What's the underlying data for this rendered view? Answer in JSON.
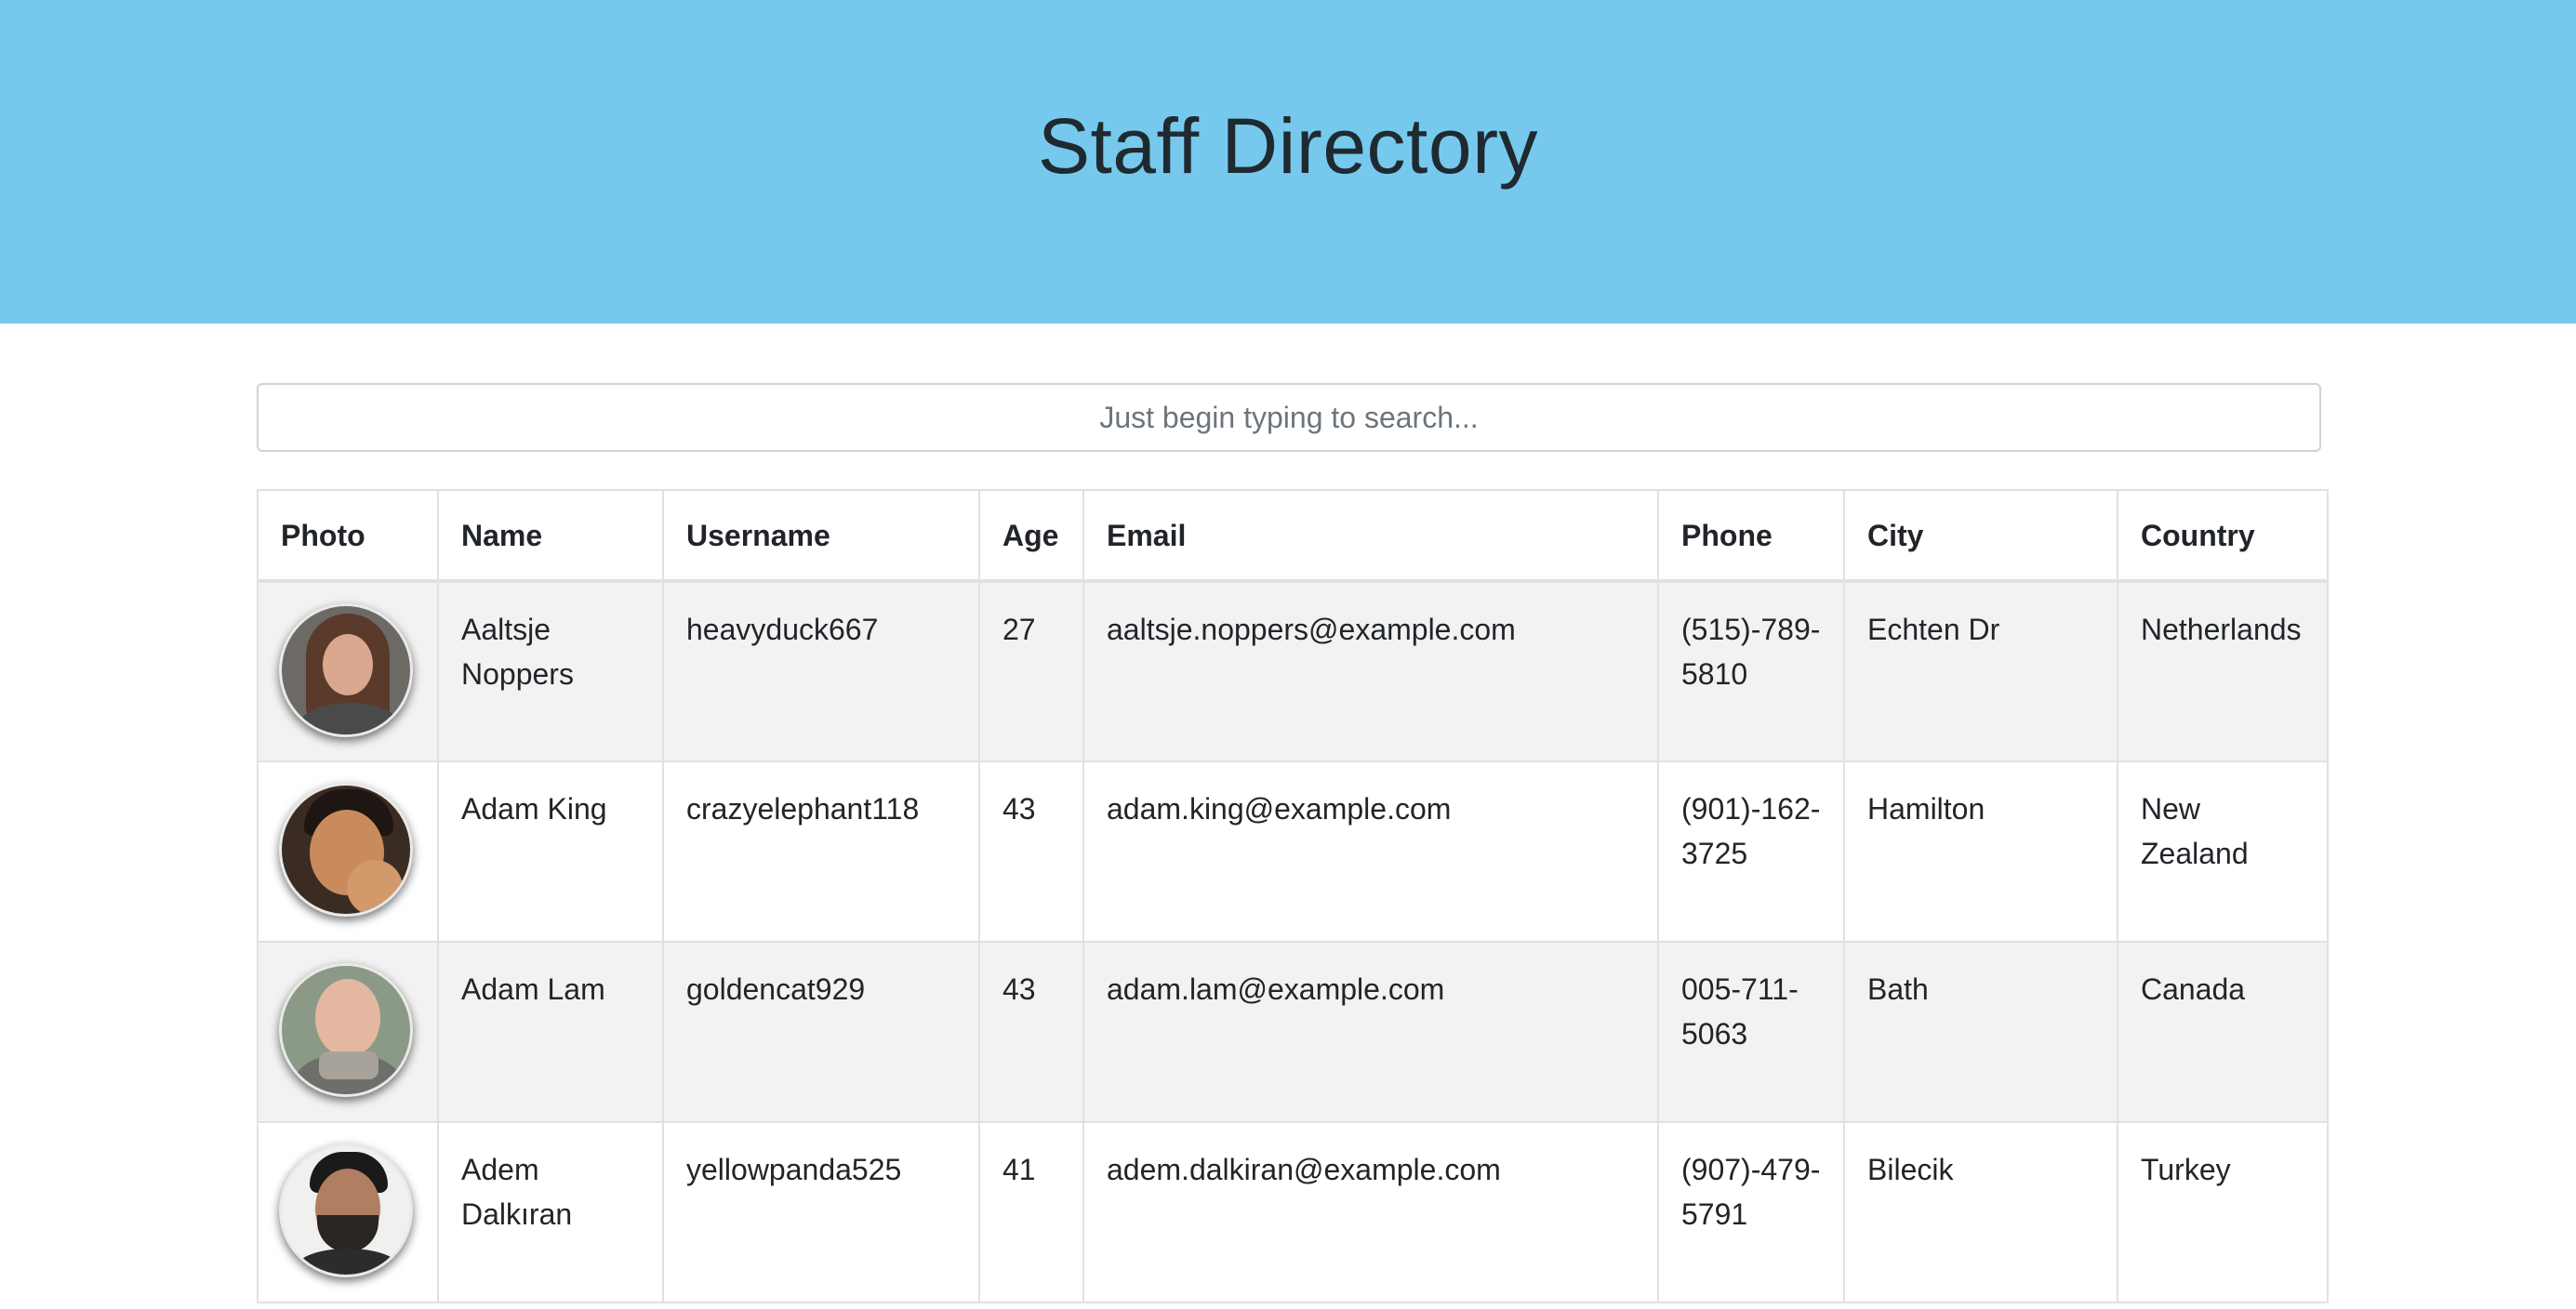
{
  "header": {
    "title": "Staff Directory"
  },
  "search": {
    "placeholder": "Just begin typing to search..."
  },
  "table": {
    "columns": [
      "Photo",
      "Name",
      "Username",
      "Age",
      "Email",
      "Phone",
      "City",
      "Country"
    ],
    "rows": [
      {
        "photo": "avatar-woman-long-hair",
        "name": "Aaltsje Noppers",
        "username": "heavyduck667",
        "age": "27",
        "email": "aaltsje.noppers@example.com",
        "phone": "(515)-789-5810",
        "city": "Echten Dr",
        "country": "Netherlands"
      },
      {
        "photo": "avatar-man-dark-hair",
        "name": "Adam King",
        "username": "crazyelephant118",
        "age": "43",
        "email": "adam.king@example.com",
        "phone": "(901)-162-3725",
        "city": "Hamilton",
        "country": "New Zealand"
      },
      {
        "photo": "avatar-man-bald-scarf",
        "name": "Adam Lam",
        "username": "goldencat929",
        "age": "43",
        "email": "adam.lam@example.com",
        "phone": "005-711-5063",
        "city": "Bath",
        "country": "Canada"
      },
      {
        "photo": "avatar-man-beard",
        "name": "Adem Dalkıran",
        "username": "yellowpanda525",
        "age": "41",
        "email": "adem.dalkiran@example.com",
        "phone": "(907)-479-5791",
        "city": "Bilecik",
        "country": "Turkey"
      }
    ]
  },
  "colors": {
    "header_bg": "#76c9ed",
    "stripe_bg": "#f2f2f2",
    "border": "#dee2e6"
  }
}
